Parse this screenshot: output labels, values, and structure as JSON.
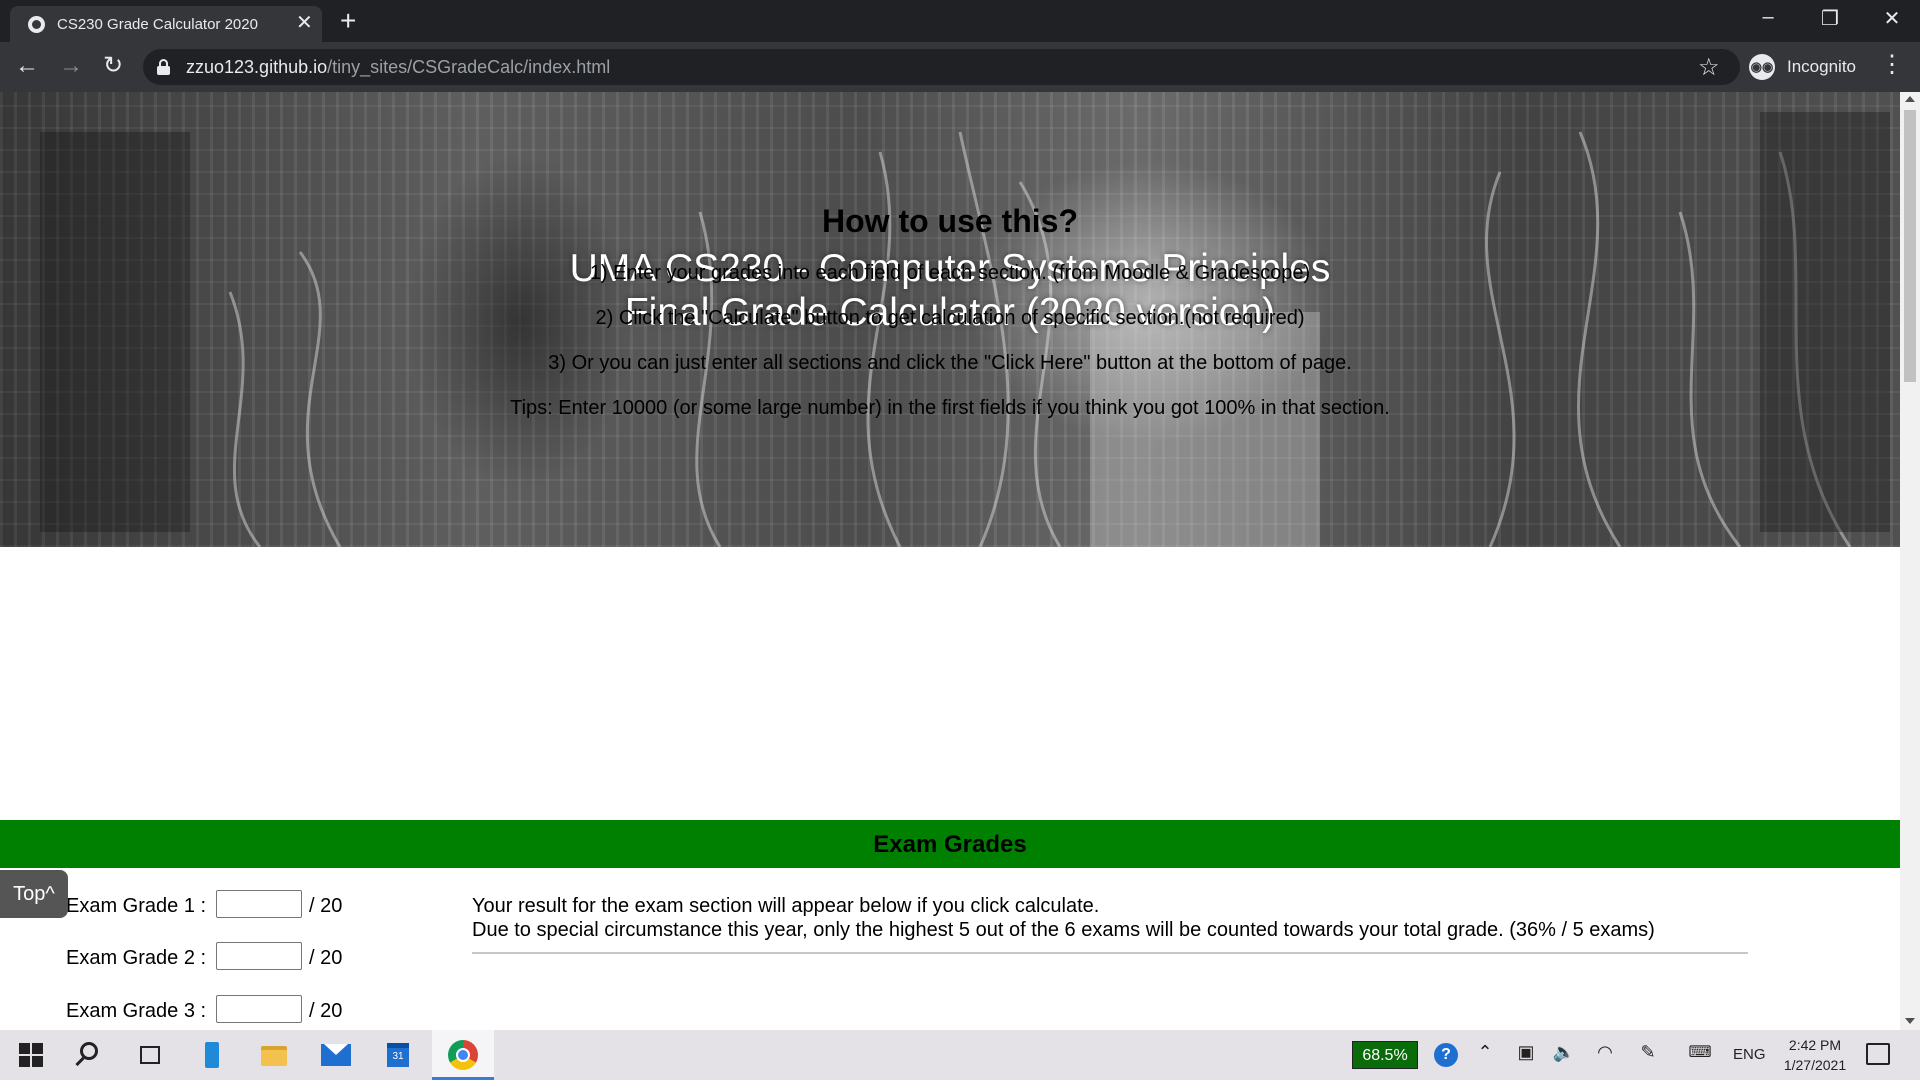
{
  "browser": {
    "tab_title": "CS230 Grade Calculator 2020",
    "url_host": "zzuo123.github.io",
    "url_path": "/tiny_sites/CSGradeCalc/index.html",
    "profile_label": "Incognito"
  },
  "hero": {
    "title_line1": "UMA CS230 - Computer Systems Principles",
    "title_line2": "Final Grade Calculator (2020 version)"
  },
  "howto": {
    "heading": "How to use this?",
    "steps": [
      "1) Enter your grades into each field of each section. (from Moodle & Gradescope)",
      "2) Click the \"Calculate\" button to get calculation of specific section.(not required)",
      "3) Or you can just enter all sections and click the \"Click Here\" button at the bottom of page.",
      "Tips: Enter 10000 (or some large number) in the first fields if you think you got 100% in that section."
    ]
  },
  "exam_section": {
    "title": "Exam Grades",
    "rows": [
      {
        "label": "Exam Grade 1 :",
        "value": "",
        "max": "/ 20"
      },
      {
        "label": "Exam Grade 2 :",
        "value": "",
        "max": "/ 20"
      },
      {
        "label": "Exam Grade 3 :",
        "value": "",
        "max": "/ 20"
      }
    ],
    "result_line1": "Your result for the exam section will appear below if you click calculate.",
    "result_line2": "Due to special circumstance this year, only the highest 5 out of the 6 exams will be counted towards your total grade. (36% / 5 exams)"
  },
  "top_button": "Top^",
  "taskbar": {
    "battery": "68.5%",
    "language": "ENG",
    "time": "2:42 PM",
    "date": "1/27/2021",
    "calendar_day": "31"
  }
}
